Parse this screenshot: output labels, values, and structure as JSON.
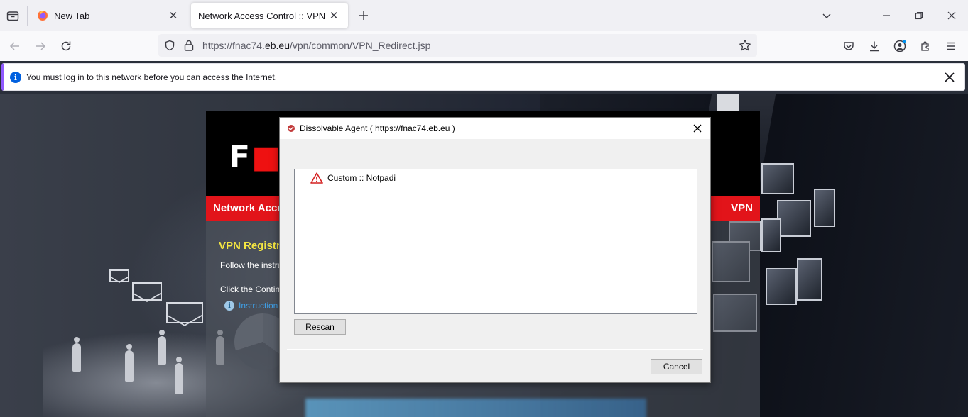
{
  "browser": {
    "tabs": [
      {
        "label": "New Tab",
        "icon": "firefox-icon",
        "active": false
      },
      {
        "label": "Network Access Control :: VPN",
        "icon": "none",
        "active": true
      }
    ],
    "url": {
      "prefix": "https://fnac74.",
      "host": "eb.eu",
      "path": "/vpn/common/VPN_Redirect.jsp"
    },
    "notification": "You must log in to this network before you can access the Internet."
  },
  "portal": {
    "logo_left": "F",
    "logo_right": "",
    "header_left": "Network Acce",
    "header_right": "VPN",
    "title": "VPN Registr",
    "line1": "Follow the instru",
    "line2": "Click the Contin",
    "instructions_link": "Instruction"
  },
  "dialog": {
    "title": "Dissolvable Agent  ( https://fnac74.eb.eu )",
    "items": [
      {
        "label": "Custom :: Notpadi",
        "icon": "warning-icon"
      }
    ],
    "rescan_label": "Rescan",
    "cancel_label": "Cancel"
  },
  "colors": {
    "accent_red": "#e2141a",
    "title_yellow": "#f5e642",
    "link_blue": "#3fa0e8",
    "info_blue": "#0060df"
  }
}
